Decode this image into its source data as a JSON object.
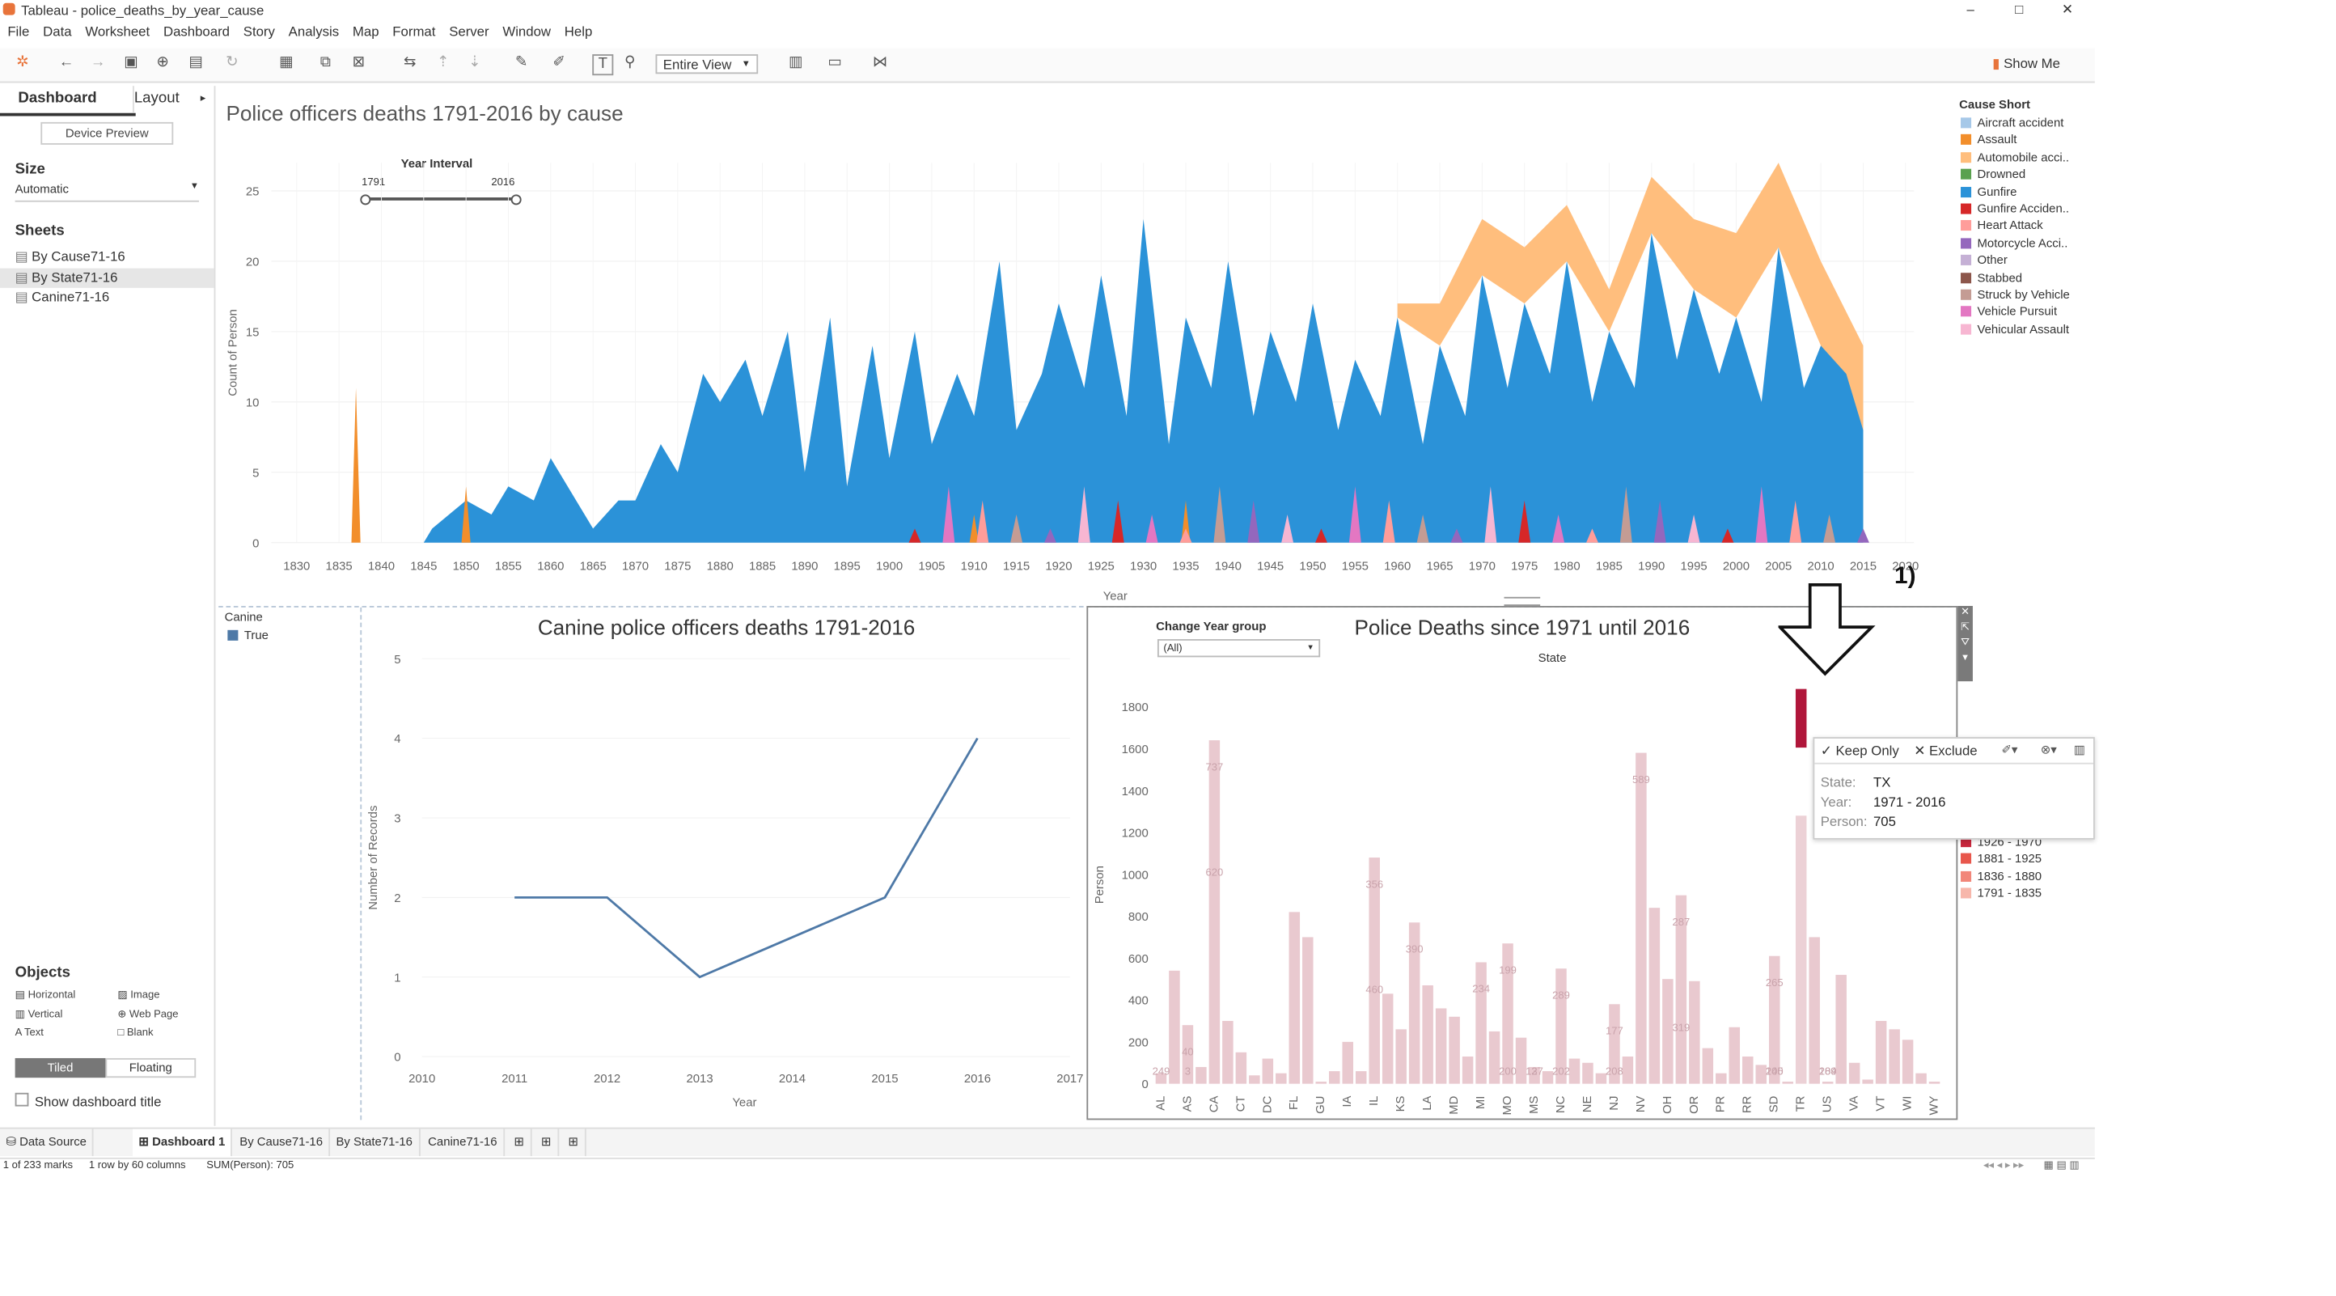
{
  "window": {
    "title": "Tableau - police_deaths_by_year_cause",
    "controls": [
      "–",
      "□",
      "✕"
    ]
  },
  "menu": [
    "File",
    "Data",
    "Worksheet",
    "Dashboard",
    "Story",
    "Analysis",
    "Map",
    "Format",
    "Server",
    "Window",
    "Help"
  ],
  "toolbar": {
    "view_select": "Entire View",
    "show_me": "Show Me"
  },
  "side": {
    "tab_dashboard": "Dashboard",
    "tab_layout": "Layout",
    "device_preview": "Device Preview",
    "size_label": "Size",
    "size_value": "Automatic",
    "sheets_label": "Sheets",
    "sheets": [
      "By Cause71-16",
      "By State71-16",
      "Canine71-16"
    ],
    "objects_label": "Objects",
    "objects": [
      "Horizontal",
      "Image",
      "Vertical",
      "Web Page",
      "Text",
      "Blank"
    ],
    "tiled": "Tiled",
    "floating": "Floating",
    "show_title": "Show dashboard title"
  },
  "top_chart": {
    "title": "Police officers deaths 1791-2016 by cause",
    "filter_title": "Year Interval",
    "filter_min": "1791",
    "filter_max": "2016",
    "ylabel": "Count of Person",
    "xlabel": "Year",
    "yticks": [
      "0",
      "5",
      "10",
      "15",
      "20",
      "25"
    ],
    "xticks": [
      "1830",
      "1835",
      "1840",
      "1845",
      "1850",
      "1855",
      "1860",
      "1865",
      "1870",
      "1875",
      "1880",
      "1885",
      "1890",
      "1895",
      "1900",
      "1905",
      "1910",
      "1915",
      "1920",
      "1925",
      "1930",
      "1935",
      "1940",
      "1945",
      "1950",
      "1955",
      "1960",
      "1965",
      "1970",
      "1975",
      "1980",
      "1985",
      "1990",
      "1995",
      "2000",
      "2005",
      "2010",
      "2015",
      "2020"
    ]
  },
  "legend_cause": {
    "title": "Cause Short",
    "items": [
      {
        "label": "Aircraft accident",
        "color": "#a6c8e8"
      },
      {
        "label": "Assault",
        "color": "#f28e2b"
      },
      {
        "label": "Automobile acci..",
        "color": "#ffbe7d"
      },
      {
        "label": "Drowned",
        "color": "#59a14f"
      },
      {
        "label": "Gunfire",
        "color": "#2b92d8"
      },
      {
        "label": "Gunfire Acciden..",
        "color": "#d62728"
      },
      {
        "label": "Heart Attack",
        "color": "#ff9d9a"
      },
      {
        "label": "Motorcycle Acci..",
        "color": "#9467bd"
      },
      {
        "label": "Other",
        "color": "#c5b0d5"
      },
      {
        "label": "Stabbed",
        "color": "#8c564b"
      },
      {
        "label": "Struck by Vehicle",
        "color": "#c49c94"
      },
      {
        "label": "Vehicle Pursuit",
        "color": "#e377c2"
      },
      {
        "label": "Vehicular Assault",
        "color": "#f7b6d2"
      }
    ]
  },
  "canine_legend": {
    "title": "Canine",
    "item": "True",
    "color": "#4e79a7"
  },
  "annotation": "1)",
  "tooltip": {
    "keep_only": "✓ Keep Only",
    "exclude": "✕ Exclude",
    "rows": [
      {
        "k": "State:",
        "v": "TX"
      },
      {
        "k": "Year:",
        "v": "1971 - 2016"
      },
      {
        "k": "Person:",
        "v": "705"
      }
    ]
  },
  "year_legend": [
    {
      "label": "1926 - 1970",
      "color": "#c8263c"
    },
    {
      "label": "1881 - 1925",
      "color": "#e8574c"
    },
    {
      "label": "1836 - 1880",
      "color": "#f2877a"
    },
    {
      "label": "1791 - 1835",
      "color": "#f7b7ab"
    }
  ],
  "tabs": [
    "Data Source",
    "Dashboard 1",
    "By Cause71-16",
    "By State71-16",
    "Canine71-16"
  ],
  "status": [
    "1 of 233 marks",
    "1 row by 60 columns",
    "SUM(Person): 705"
  ],
  "chart_data": [
    {
      "type": "area",
      "title": "Police officers deaths 1791-2016 by cause",
      "xlabel": "Year",
      "ylabel": "Count of Person",
      "xlim": [
        1827,
        2021
      ],
      "ylim": [
        0,
        27
      ],
      "series": [
        {
          "name": "Gunfire",
          "x": [
            1837,
            1840,
            1845,
            1846,
            1850,
            1853,
            1855,
            1858,
            1860,
            1863,
            1865,
            1868,
            1870,
            1873,
            1875,
            1878,
            1880,
            1883,
            1885,
            1888,
            1890,
            1893,
            1895,
            1898,
            1900,
            1903,
            1905,
            1908,
            1910,
            1913,
            1915,
            1918,
            1920,
            1923,
            1925,
            1928,
            1930,
            1933,
            1935,
            1938,
            1940,
            1943,
            1945,
            1948,
            1950,
            1953,
            1955,
            1958,
            1960,
            1963,
            1965,
            1968,
            1970,
            1973,
            1975,
            1978,
            1980,
            1983,
            1985,
            1988,
            1990,
            1993,
            1995,
            1998,
            2000,
            2003,
            2005,
            2008,
            2010,
            2013,
            2015
          ],
          "values": [
            0,
            0,
            0,
            1,
            3,
            2,
            4,
            3,
            6,
            3,
            1,
            3,
            3,
            7,
            5,
            12,
            10,
            13,
            9,
            15,
            5,
            16,
            4,
            14,
            6,
            15,
            7,
            12,
            9,
            20,
            8,
            12,
            17,
            11,
            19,
            9,
            23,
            7,
            16,
            11,
            20,
            9,
            15,
            10,
            17,
            8,
            13,
            9,
            16,
            7,
            14,
            9,
            19,
            11,
            17,
            12,
            20,
            10,
            15,
            11,
            22,
            13,
            18,
            12,
            16,
            10,
            21,
            11,
            14,
            12,
            8
          ]
        },
        {
          "name": "Automobile acci..",
          "x": [
            1960,
            1965,
            1970,
            1975,
            1980,
            1985,
            1990,
            1995,
            2000,
            2005,
            2010,
            2015
          ],
          "values": [
            1,
            3,
            4,
            4,
            4,
            3,
            4,
            5,
            6,
            6,
            6,
            6
          ]
        },
        {
          "name": "Assault",
          "x": [
            1837,
            1850,
            1910,
            1935
          ],
          "values": [
            11,
            4,
            2,
            3
          ]
        }
      ]
    },
    {
      "type": "line",
      "title": "Canine police officers deaths 1791-2016",
      "xlabel": "Year",
      "ylabel": "Number of Records",
      "series": [
        {
          "name": "True",
          "x": [
            2011,
            2012,
            2013,
            2014,
            2015,
            2016
          ],
          "values": [
            2,
            2,
            1,
            1.5,
            2,
            4
          ]
        }
      ],
      "xticks": [
        "2010",
        "2011",
        "2012",
        "2013",
        "2014",
        "2015",
        "2016",
        "2017"
      ],
      "yticks": [
        "0",
        "1",
        "2",
        "3",
        "4",
        "5"
      ],
      "ylim": [
        0,
        5
      ]
    },
    {
      "type": "bar",
      "title": "Police Deaths since 1971 until 2016",
      "subtitle": "State",
      "ylabel": "Person",
      "filter_title": "Change Year group",
      "filter_value": "(All)",
      "categories": [
        "AL",
        "",
        "AS",
        "",
        "CA",
        "",
        "CT",
        "",
        "DC",
        "",
        "FL",
        "",
        "GU",
        "",
        "IA",
        "",
        "IL",
        "",
        "KS",
        "",
        "LA",
        "",
        "MD",
        "",
        "MI",
        "",
        "MO",
        "",
        "MS",
        "",
        "NC",
        "",
        "NE",
        "",
        "NJ",
        "",
        "NV",
        "",
        "OH",
        "",
        "OR",
        "",
        "PR",
        "",
        "RR",
        "",
        "SD",
        "",
        "TR",
        "",
        "US",
        "",
        "VA",
        "",
        "VT",
        "",
        "WI",
        "",
        "WY"
      ],
      "values": [
        50,
        540,
        280,
        80,
        1640,
        300,
        150,
        40,
        120,
        50,
        820,
        700,
        10,
        60,
        200,
        60,
        1080,
        430,
        260,
        770,
        470,
        360,
        320,
        130,
        580,
        250,
        670,
        220,
        80,
        60,
        550,
        120,
        100,
        50,
        380,
        130,
        1580,
        840,
        500,
        900,
        490,
        170,
        50,
        270,
        130,
        90,
        610,
        10,
        1280,
        700,
        10,
        520,
        100,
        20,
        300,
        260,
        210,
        50,
        10
      ],
      "highlight": {
        "category_index": 48,
        "value": 705
      },
      "ylim": [
        0,
        1900
      ],
      "yticks": [
        "0",
        "200",
        "400",
        "600",
        "800",
        "1000",
        "1200",
        "1400",
        "1600",
        "1800"
      ],
      "labels": [
        {
          "i": 0,
          "text": "249"
        },
        {
          "i": 2,
          "text": "40"
        },
        {
          "i": 2,
          "text": "3"
        },
        {
          "i": 4,
          "text": "737"
        },
        {
          "i": 4,
          "text": "620"
        },
        {
          "i": 16,
          "text": "356"
        },
        {
          "i": 16,
          "text": "460"
        },
        {
          "i": 19,
          "text": "390"
        },
        {
          "i": 24,
          "text": "234"
        },
        {
          "i": 26,
          "text": "199"
        },
        {
          "i": 26,
          "text": "200"
        },
        {
          "i": 28,
          "text": "127"
        },
        {
          "i": 28,
          "text": "3"
        },
        {
          "i": 30,
          "text": "289"
        },
        {
          "i": 30,
          "text": "202"
        },
        {
          "i": 34,
          "text": "177"
        },
        {
          "i": 34,
          "text": "208"
        },
        {
          "i": 36,
          "text": "589"
        },
        {
          "i": 39,
          "text": "287"
        },
        {
          "i": 39,
          "text": "319"
        },
        {
          "i": 46,
          "text": "265"
        },
        {
          "i": 46,
          "text": "200"
        },
        {
          "i": 46,
          "text": "145"
        },
        {
          "i": 50,
          "text": "184"
        },
        {
          "i": 50,
          "text": "209"
        }
      ]
    }
  ]
}
